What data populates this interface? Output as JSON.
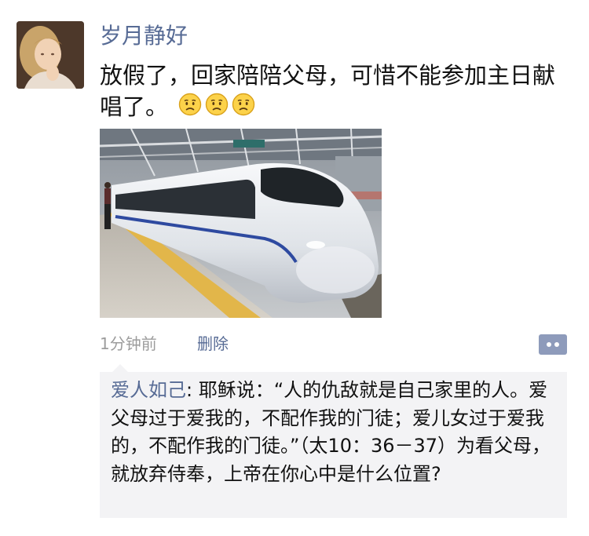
{
  "post": {
    "username": "岁月静好",
    "text": "放假了，回家陪陪父母，可惜不能参加主日献唱了。",
    "emojis": [
      "frown-emoji",
      "frown-emoji",
      "frown-emoji"
    ],
    "time": "1分钟前",
    "delete_label": "删除",
    "photo_icon": "high-speed-train-photo"
  },
  "comments": [
    {
      "author": "爱人如己",
      "separator": ": ",
      "text": "耶稣说：“人的仇敌就是自己家里的人。爱父母过于爱我的，不配作我的门徒；爱儿女过于爱我的，不配作我的门徒。”（太10：36－37）为看父母，就放弃侍奉，上帝在你心中是什么位置?"
    }
  ],
  "colors": {
    "link": "#576b95",
    "meta": "#9c9c9c",
    "comment_bg": "#f3f3f5",
    "more_button": "#8e9bbb"
  }
}
